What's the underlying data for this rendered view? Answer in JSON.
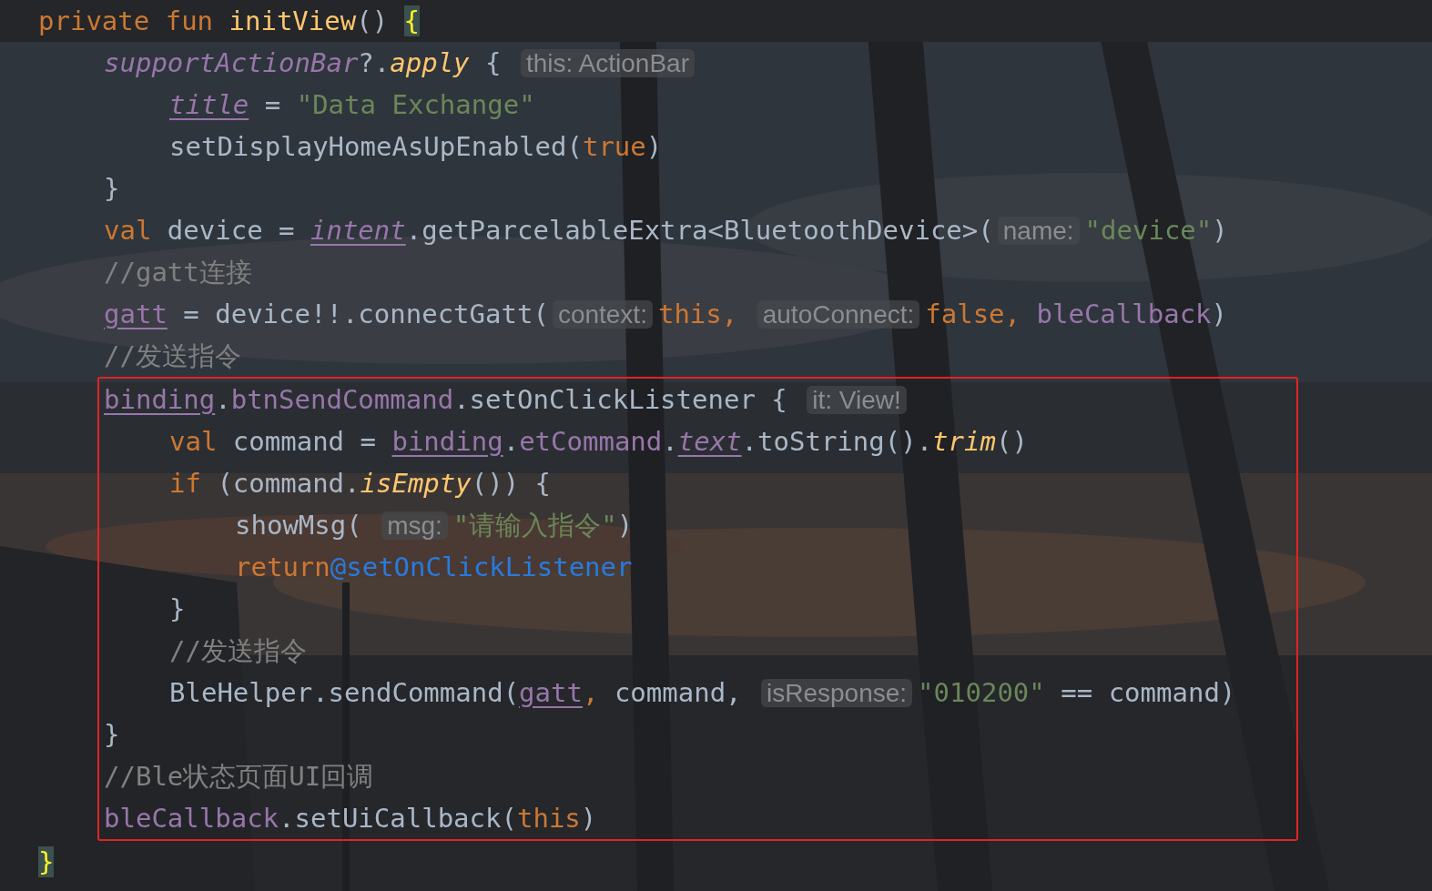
{
  "lines": [
    {
      "tokens": [
        {
          "text": "private fun ",
          "kind": "keyword"
        },
        {
          "text": "initView",
          "kind": "fn"
        },
        {
          "text": "() ",
          "kind": "plain"
        },
        {
          "text": "{",
          "kind": "brace_match"
        }
      ],
      "current": true,
      "children": [
        {
          "tokens": [
            {
              "text": "supportActionBar",
              "kind": "field_italic"
            },
            {
              "text": "?.",
              "kind": "plain"
            },
            {
              "text": "apply",
              "kind": "call_italic"
            },
            {
              "text": " { ",
              "kind": "plain"
            },
            {
              "text": "this: ActionBar",
              "kind": "hint"
            }
          ],
          "children": [
            {
              "tokens": [
                {
                  "text": "title",
                  "kind": "field_italic_ul"
                },
                {
                  "text": " = ",
                  "kind": "plain"
                },
                {
                  "text": "\"Data Exchange\"",
                  "kind": "string"
                }
              ]
            },
            {
              "tokens": [
                {
                  "text": "setDisplayHomeAsUpEnabled(",
                  "kind": "plain"
                },
                {
                  "text": "true",
                  "kind": "keyword"
                },
                {
                  "text": ")",
                  "kind": "plain"
                }
              ]
            }
          ]
        },
        {
          "tokens": [
            {
              "text": "}",
              "kind": "plain"
            }
          ]
        },
        {
          "tokens": [
            {
              "text": "val ",
              "kind": "keyword"
            },
            {
              "text": "device = ",
              "kind": "plain"
            },
            {
              "text": "intent",
              "kind": "field_italic_ul"
            },
            {
              "text": ".getParcelableExtra<BluetoothDevice>(",
              "kind": "plain"
            },
            {
              "text": "name:",
              "kind": "hint"
            },
            {
              "text": "\"device\"",
              "kind": "string"
            },
            {
              "text": ")",
              "kind": "plain"
            }
          ]
        },
        {
          "tokens": [
            {
              "text": "//gatt连接",
              "kind": "comment"
            }
          ]
        },
        {
          "tokens": [
            {
              "text": "gatt",
              "kind": "field_ul"
            },
            {
              "text": " = device!!.connectGatt(",
              "kind": "plain"
            },
            {
              "text": "context:",
              "kind": "hint"
            },
            {
              "text": "this, ",
              "kind": "keyword"
            },
            {
              "text": "autoConnect:",
              "kind": "hint"
            },
            {
              "text": "false, ",
              "kind": "keyword"
            },
            {
              "text": "bleCallback",
              "kind": "field"
            },
            {
              "text": ")",
              "kind": "plain"
            }
          ]
        },
        {
          "tokens": [
            {
              "text": "//发送指令",
              "kind": "comment"
            }
          ]
        },
        {
          "tokens": [
            {
              "text": "binding",
              "kind": "field_ul"
            },
            {
              "text": ".",
              "kind": "plain"
            },
            {
              "text": "btnSendCommand",
              "kind": "field"
            },
            {
              "text": ".setOnClickListener { ",
              "kind": "plain"
            },
            {
              "text": "it: View!",
              "kind": "hint"
            }
          ],
          "boxed": true,
          "children": [
            {
              "tokens": [
                {
                  "text": "val ",
                  "kind": "keyword"
                },
                {
                  "text": "command = ",
                  "kind": "plain"
                },
                {
                  "text": "binding",
                  "kind": "field_ul"
                },
                {
                  "text": ".",
                  "kind": "plain"
                },
                {
                  "text": "etCommand",
                  "kind": "field"
                },
                {
                  "text": ".",
                  "kind": "plain"
                },
                {
                  "text": "text",
                  "kind": "field_italic_ul"
                },
                {
                  "text": ".toString().",
                  "kind": "plain"
                },
                {
                  "text": "trim",
                  "kind": "call_italic"
                },
                {
                  "text": "()",
                  "kind": "plain"
                }
              ]
            },
            {
              "tokens": [
                {
                  "text": "if ",
                  "kind": "keyword"
                },
                {
                  "text": "(command.",
                  "kind": "plain"
                },
                {
                  "text": "isEmpty",
                  "kind": "call_italic"
                },
                {
                  "text": "()) {",
                  "kind": "plain"
                }
              ],
              "children": [
                {
                  "tokens": [
                    {
                      "text": "showMsg( ",
                      "kind": "plain"
                    },
                    {
                      "text": "msg:",
                      "kind": "hint"
                    },
                    {
                      "text": "\"请输入指令\"",
                      "kind": "string"
                    },
                    {
                      "text": ")",
                      "kind": "plain"
                    }
                  ]
                },
                {
                  "tokens": [
                    {
                      "text": "return",
                      "kind": "keyword"
                    },
                    {
                      "text": "@setOnClickListener",
                      "kind": "label"
                    }
                  ]
                }
              ]
            },
            {
              "tokens": [
                {
                  "text": "}",
                  "kind": "plain"
                }
              ]
            },
            {
              "tokens": [
                {
                  "text": "//发送指令",
                  "kind": "comment"
                }
              ]
            },
            {
              "tokens": [
                {
                  "text": "BleHelper.sendCommand(",
                  "kind": "plain"
                },
                {
                  "text": "gatt",
                  "kind": "field_ul"
                },
                {
                  "text": ", ",
                  "kind": "keyword"
                },
                {
                  "text": "command, ",
                  "kind": "plain"
                },
                {
                  "text": "isResponse:",
                  "kind": "hint"
                },
                {
                  "text": "\"010200\"",
                  "kind": "string"
                },
                {
                  "text": " == command)",
                  "kind": "plain"
                }
              ]
            }
          ]
        },
        {
          "tokens": [
            {
              "text": "}",
              "kind": "plain"
            }
          ],
          "boxed": true
        },
        {
          "tokens": [
            {
              "text": "//Ble状态页面UI回调",
              "kind": "comment"
            }
          ],
          "boxed": true
        },
        {
          "tokens": [
            {
              "text": "bleCallback",
              "kind": "field"
            },
            {
              "text": ".setUiCallback(",
              "kind": "plain"
            },
            {
              "text": "this",
              "kind": "keyword"
            },
            {
              "text": ")",
              "kind": "plain"
            }
          ],
          "boxed": true
        }
      ]
    },
    {
      "tokens": [
        {
          "text": "}",
          "kind": "brace_match"
        }
      ]
    }
  ]
}
